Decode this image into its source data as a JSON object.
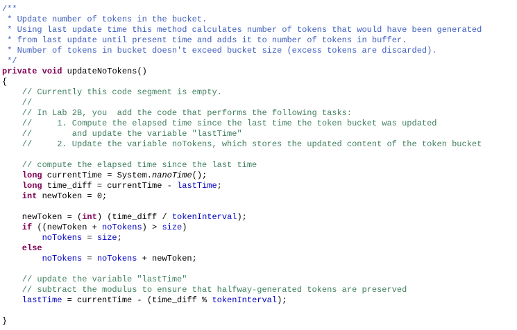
{
  "editor": {
    "lines": [
      {
        "indent": 3,
        "tokens": [
          {
            "t": "/**",
            "c": "doc"
          }
        ]
      },
      {
        "indent": 3,
        "tokens": [
          {
            "t": " * Update number of tokens in the bucket.",
            "c": "doc"
          }
        ]
      },
      {
        "indent": 3,
        "tokens": [
          {
            "t": " * Using last update time this method calculates number of tokens that would have been generated",
            "c": "doc"
          }
        ]
      },
      {
        "indent": 3,
        "tokens": [
          {
            "t": " * from last update until present time and adds it to number of tokens in buffer.",
            "c": "doc"
          }
        ]
      },
      {
        "indent": 3,
        "tokens": [
          {
            "t": " * Number of tokens in bucket doesn't exceed bucket size (excess tokens are discarded).",
            "c": "doc"
          }
        ]
      },
      {
        "indent": 3,
        "tokens": [
          {
            "t": " */",
            "c": "doc"
          }
        ]
      },
      {
        "indent": 3,
        "tokens": [
          {
            "t": "private",
            "c": "kw"
          },
          {
            "t": " ",
            "c": "plain"
          },
          {
            "t": "void",
            "c": "kw"
          },
          {
            "t": " updateNoTokens()",
            "c": "plain"
          }
        ]
      },
      {
        "indent": 3,
        "tokens": [
          {
            "t": "{",
            "c": "plain"
          }
        ]
      },
      {
        "indent": 7,
        "tokens": [
          {
            "t": "// Currently this code segment is empty.",
            "c": "cmt"
          }
        ]
      },
      {
        "indent": 7,
        "tokens": [
          {
            "t": "//",
            "c": "cmt"
          }
        ]
      },
      {
        "indent": 7,
        "tokens": [
          {
            "t": "// In Lab 2B, you  add the code that performs the following tasks:",
            "c": "cmt"
          }
        ]
      },
      {
        "indent": 7,
        "tokens": [
          {
            "t": "//     1. Compute the elapsed time since the last time the token bucket was updated",
            "c": "cmt"
          }
        ]
      },
      {
        "indent": 7,
        "tokens": [
          {
            "t": "//        and update the variable \"lastTime\"",
            "c": "cmt"
          }
        ]
      },
      {
        "indent": 7,
        "tokens": [
          {
            "t": "//     2. Update the variable noTokens, which stores the updated content of the token bucket",
            "c": "cmt"
          }
        ]
      },
      {
        "indent": 7,
        "tokens": []
      },
      {
        "indent": 7,
        "tokens": [
          {
            "t": "// compute the elapsed time since the last time",
            "c": "cmt"
          }
        ]
      },
      {
        "indent": 7,
        "tokens": [
          {
            "t": "long",
            "c": "kw"
          },
          {
            "t": " currentTime = System.",
            "c": "plain"
          },
          {
            "t": "nanoTime",
            "c": "plain it"
          },
          {
            "t": "();",
            "c": "plain"
          }
        ]
      },
      {
        "indent": 7,
        "tokens": [
          {
            "t": "long",
            "c": "kw"
          },
          {
            "t": " time_diff = currentTime - ",
            "c": "plain"
          },
          {
            "t": "lastTime",
            "c": "fld"
          },
          {
            "t": ";",
            "c": "plain"
          }
        ]
      },
      {
        "indent": 7,
        "tokens": [
          {
            "t": "int",
            "c": "kw"
          },
          {
            "t": " newToken = 0;",
            "c": "plain"
          }
        ]
      },
      {
        "indent": 7,
        "tokens": []
      },
      {
        "indent": 7,
        "tokens": [
          {
            "t": "newToken = (",
            "c": "plain"
          },
          {
            "t": "int",
            "c": "kw"
          },
          {
            "t": ") (time_diff / ",
            "c": "plain"
          },
          {
            "t": "tokenInterval",
            "c": "fld"
          },
          {
            "t": ");",
            "c": "plain"
          }
        ]
      },
      {
        "indent": 7,
        "tokens": [
          {
            "t": "if",
            "c": "kw"
          },
          {
            "t": " ((newToken + ",
            "c": "plain"
          },
          {
            "t": "noTokens",
            "c": "fld"
          },
          {
            "t": ") > ",
            "c": "plain"
          },
          {
            "t": "size",
            "c": "fld"
          },
          {
            "t": ")",
            "c": "plain"
          }
        ]
      },
      {
        "indent": 11,
        "tokens": [
          {
            "t": "noTokens",
            "c": "fld"
          },
          {
            "t": " = ",
            "c": "plain"
          },
          {
            "t": "size",
            "c": "fld"
          },
          {
            "t": ";",
            "c": "plain"
          }
        ]
      },
      {
        "indent": 7,
        "tokens": [
          {
            "t": "else",
            "c": "kw"
          }
        ]
      },
      {
        "indent": 11,
        "tokens": [
          {
            "t": "noTokens",
            "c": "fld"
          },
          {
            "t": " = ",
            "c": "plain"
          },
          {
            "t": "noTokens",
            "c": "fld"
          },
          {
            "t": " + newToken;",
            "c": "plain"
          }
        ]
      },
      {
        "indent": 7,
        "tokens": []
      },
      {
        "indent": 7,
        "tokens": [
          {
            "t": "// update the variable \"lastTime\"",
            "c": "cmt"
          }
        ]
      },
      {
        "indent": 7,
        "tokens": [
          {
            "t": "// subtract the modulus to ensure that halfway-generated tokens are preserved",
            "c": "cmt"
          }
        ]
      },
      {
        "indent": 7,
        "tokens": [
          {
            "t": "lastTime",
            "c": "fld"
          },
          {
            "t": " = currentTime - (time_diff % ",
            "c": "plain"
          },
          {
            "t": "tokenInterval",
            "c": "fld"
          },
          {
            "t": ");",
            "c": "plain"
          }
        ]
      },
      {
        "indent": 7,
        "tokens": []
      },
      {
        "indent": 3,
        "tokens": [
          {
            "t": "}",
            "c": "plain"
          }
        ]
      }
    ]
  }
}
